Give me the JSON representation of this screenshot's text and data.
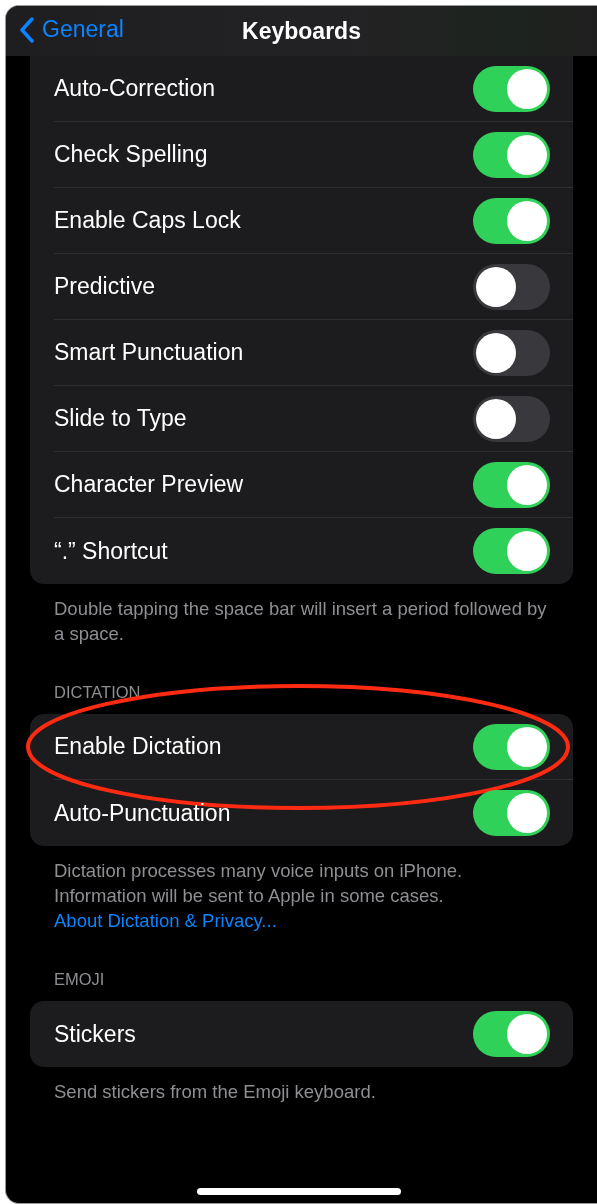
{
  "nav": {
    "back": "General",
    "title": "Keyboards"
  },
  "groups": [
    {
      "rows": [
        {
          "label": "Auto-Correction",
          "on": true,
          "circled": false
        },
        {
          "label": "Check Spelling",
          "on": true,
          "circled": false
        },
        {
          "label": "Enable Caps Lock",
          "on": true,
          "circled": false
        },
        {
          "label": "Predictive",
          "on": false,
          "circled": false
        },
        {
          "label": "Smart Punctuation",
          "on": false,
          "circled": false
        },
        {
          "label": "Slide to Type",
          "on": false,
          "circled": false
        },
        {
          "label": "Character Preview",
          "on": true,
          "circled": false
        },
        {
          "label": "“.” Shortcut",
          "on": true,
          "circled": false
        }
      ],
      "footer": {
        "text": "Double tapping the space bar will insert a period followed by a space."
      }
    },
    {
      "header": "DICTATION",
      "rows": [
        {
          "label": "Enable Dictation",
          "on": true,
          "circled": true
        },
        {
          "label": "Auto-Punctuation",
          "on": true,
          "circled": false
        }
      ],
      "footer": {
        "text": "Dictation processes many voice inputs on iPhone. Information will be sent to Apple in some cases.",
        "link": "About Dictation & Privacy..."
      }
    },
    {
      "header": "EMOJI",
      "rows": [
        {
          "label": "Stickers",
          "on": true,
          "circled": false
        }
      ],
      "footer": {
        "text": "Send stickers from the Emoji keyboard."
      }
    }
  ]
}
